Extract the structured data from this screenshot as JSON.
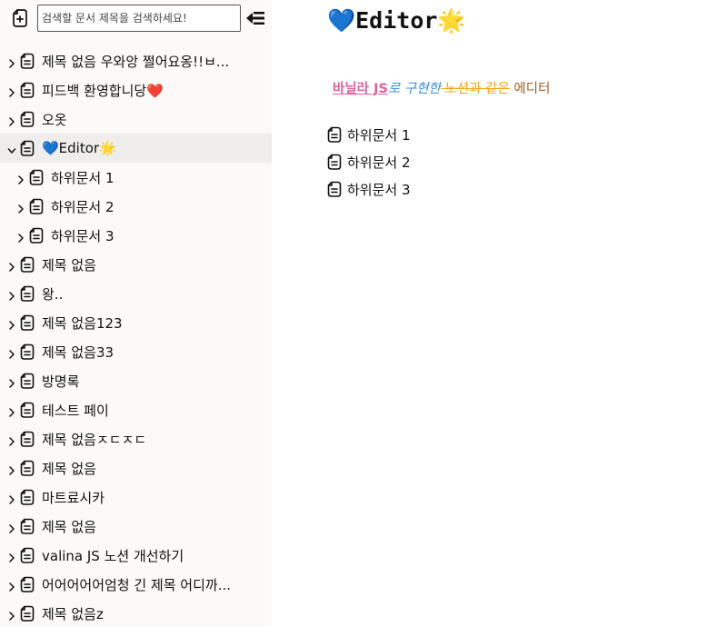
{
  "sidebar": {
    "search": {
      "placeholder": "검색할 문서 제목을 검색하세요!",
      "value": ""
    },
    "tree": [
      {
        "title": "제목 없음 우와앙 쩔어요옹!!ㅂ...",
        "expanded": false
      },
      {
        "title": "피드백 환영합니당❤️",
        "expanded": false
      },
      {
        "title": "오옷",
        "expanded": false
      },
      {
        "title": "💙Editor🌟",
        "expanded": true,
        "selected": true,
        "children": [
          {
            "title": "하위문서 1"
          },
          {
            "title": "하위문서 2"
          },
          {
            "title": "하위문서 3"
          }
        ]
      },
      {
        "title": "제목 없음",
        "expanded": false
      },
      {
        "title": "왕..",
        "expanded": false
      },
      {
        "title": "제목 없음123",
        "expanded": false
      },
      {
        "title": "제목 없음33",
        "expanded": false
      },
      {
        "title": "방명록",
        "expanded": false
      },
      {
        "title": "테스트 페이",
        "expanded": false
      },
      {
        "title": "제목 없음ㅈㄷㅈㄷ",
        "expanded": false
      },
      {
        "title": "제목 없음",
        "expanded": false
      },
      {
        "title": "마트료시카",
        "expanded": false
      },
      {
        "title": "제목 없음",
        "expanded": false
      },
      {
        "title": "valina JS 노션 개선하기",
        "expanded": false
      },
      {
        "title": "어어어어어엄청 긴 제목 어디까...",
        "expanded": false
      },
      {
        "title": "제목 없음z",
        "expanded": false
      }
    ]
  },
  "editor": {
    "title": "💙Editor🌟",
    "body": {
      "seg1": "바닐라 JS",
      "seg2": "로 구현한",
      "seg3": " 노션과 같은",
      "seg4": " 에디터"
    },
    "children": [
      {
        "title": "하위문서 1"
      },
      {
        "title": "하위문서 2"
      },
      {
        "title": "하위문서 3"
      }
    ]
  },
  "colors": {
    "sidebar_bg": "#fbfaf8",
    "selected_row_bg": "#efeeec",
    "pink": "#e0609a",
    "blue": "#3b8de0",
    "orange": "#f0a81a",
    "brown": "#9a6323"
  },
  "icons": [
    "new-doc-icon",
    "collapse-sidebar-icon",
    "chevron-right-icon",
    "chevron-down-icon",
    "document-icon"
  ]
}
